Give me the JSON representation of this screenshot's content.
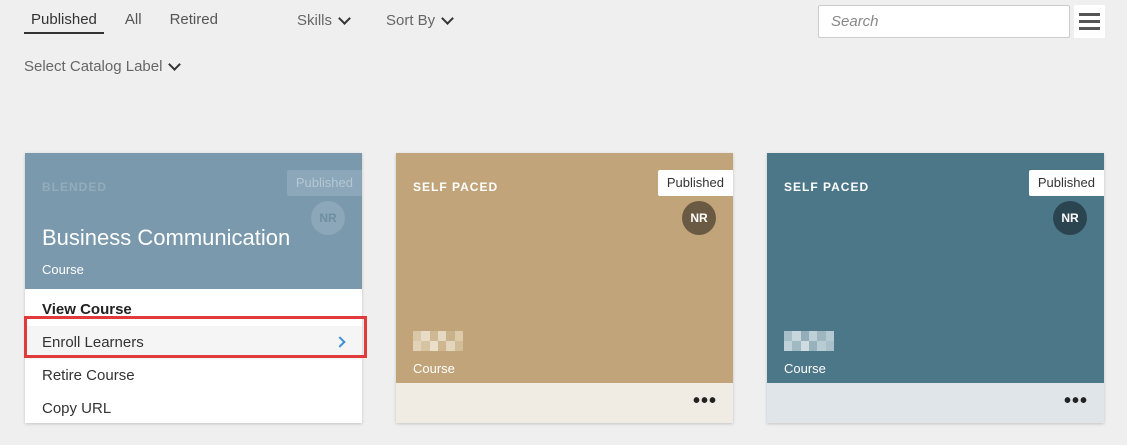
{
  "tabs": [
    {
      "label": "Published",
      "active": true
    },
    {
      "label": "All",
      "active": false
    },
    {
      "label": "Retired",
      "active": false
    }
  ],
  "filters": {
    "skills": "Skills",
    "sort_by": "Sort By",
    "catalog_label": "Select Catalog Label"
  },
  "search": {
    "placeholder": "Search",
    "value": ""
  },
  "cards": [
    {
      "type": "BLENDED",
      "status": "Published",
      "avatar": "NR",
      "title": "Business Communication",
      "kind": "Course",
      "menu": [
        "View Course",
        "Enroll Learners",
        "Retire Course",
        "Copy URL"
      ]
    },
    {
      "type": "SELF PACED",
      "status": "Published",
      "avatar": "NR",
      "kind": "Course",
      "color": "#c1a479",
      "footer_color": "#f0ebe3"
    },
    {
      "type": "SELF PACED",
      "status": "Published",
      "avatar": "NR",
      "kind": "Course",
      "color": "#4b7788",
      "footer_color": "#dfe5e8"
    }
  ],
  "colors": {
    "highlight_border": "#e03a3a",
    "arrow": "#3d8ed8"
  }
}
